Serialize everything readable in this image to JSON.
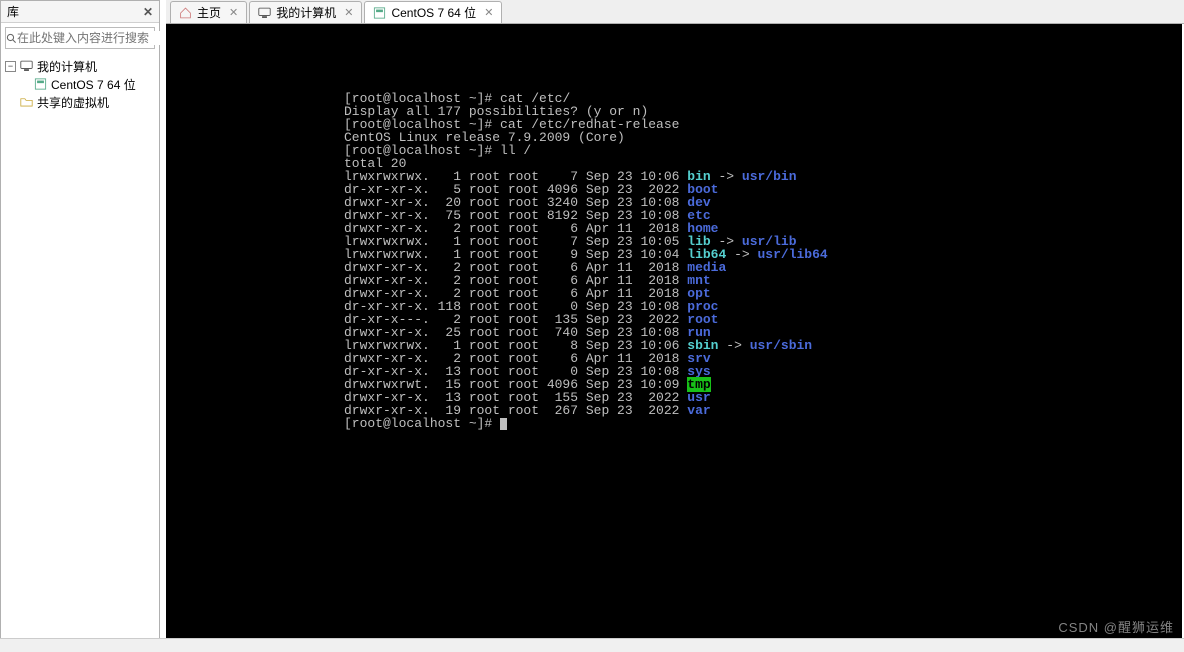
{
  "sidebar": {
    "title": "库",
    "search_placeholder": "在此处键入内容进行搜索",
    "tree": {
      "root": "我的计算机",
      "vm": "CentOS 7 64 位",
      "shared": "共享的虚拟机"
    }
  },
  "tabs": {
    "home": "主页",
    "mycomputer": "我的计算机",
    "centos": "CentOS 7 64 位"
  },
  "terminal": {
    "l1_prompt": "[root@localhost ~]# ",
    "l1_cmd": "cat /etc/",
    "l2": "Display all 177 possibilities? (y or n)",
    "l3_prompt": "[root@localhost ~]# ",
    "l3_cmd": "cat /etc/redhat-release",
    "l4": "CentOS Linux release 7.9.2009 (Core)",
    "l5_prompt": "[root@localhost ~]# ",
    "l5_cmd": "ll /",
    "l6": "total 20",
    "rows": [
      {
        "perm": "lrwxrwxrwx.",
        "n": "  1",
        "own": "root root",
        "sz": "   7",
        "date": "Sep 23 10:06",
        "name": "bin",
        "type": "lnk",
        "arrow": " -> ",
        "target": "usr/bin"
      },
      {
        "perm": "dr-xr-xr-x.",
        "n": "  5",
        "own": "root root",
        "sz": "4096",
        "date": "Sep 23  2022",
        "name": "boot",
        "type": "dir"
      },
      {
        "perm": "drwxr-xr-x.",
        "n": " 20",
        "own": "root root",
        "sz": "3240",
        "date": "Sep 23 10:08",
        "name": "dev",
        "type": "dir"
      },
      {
        "perm": "drwxr-xr-x.",
        "n": " 75",
        "own": "root root",
        "sz": "8192",
        "date": "Sep 23 10:08",
        "name": "etc",
        "type": "dir"
      },
      {
        "perm": "drwxr-xr-x.",
        "n": "  2",
        "own": "root root",
        "sz": "   6",
        "date": "Apr 11  2018",
        "name": "home",
        "type": "dir"
      },
      {
        "perm": "lrwxrwxrwx.",
        "n": "  1",
        "own": "root root",
        "sz": "   7",
        "date": "Sep 23 10:05",
        "name": "lib",
        "type": "lnk",
        "arrow": " -> ",
        "target": "usr/lib"
      },
      {
        "perm": "lrwxrwxrwx.",
        "n": "  1",
        "own": "root root",
        "sz": "   9",
        "date": "Sep 23 10:04",
        "name": "lib64",
        "type": "lnk",
        "arrow": " -> ",
        "target": "usr/lib64"
      },
      {
        "perm": "drwxr-xr-x.",
        "n": "  2",
        "own": "root root",
        "sz": "   6",
        "date": "Apr 11  2018",
        "name": "media",
        "type": "dir"
      },
      {
        "perm": "drwxr-xr-x.",
        "n": "  2",
        "own": "root root",
        "sz": "   6",
        "date": "Apr 11  2018",
        "name": "mnt",
        "type": "dir"
      },
      {
        "perm": "drwxr-xr-x.",
        "n": "  2",
        "own": "root root",
        "sz": "   6",
        "date": "Apr 11  2018",
        "name": "opt",
        "type": "dir"
      },
      {
        "perm": "dr-xr-xr-x.",
        "n": "118",
        "own": "root root",
        "sz": "   0",
        "date": "Sep 23 10:08",
        "name": "proc",
        "type": "dir"
      },
      {
        "perm": "dr-xr-x---.",
        "n": "  2",
        "own": "root root",
        "sz": " 135",
        "date": "Sep 23  2022",
        "name": "root",
        "type": "dir"
      },
      {
        "perm": "drwxr-xr-x.",
        "n": " 25",
        "own": "root root",
        "sz": " 740",
        "date": "Sep 23 10:08",
        "name": "run",
        "type": "dir"
      },
      {
        "perm": "lrwxrwxrwx.",
        "n": "  1",
        "own": "root root",
        "sz": "   8",
        "date": "Sep 23 10:06",
        "name": "sbin",
        "type": "lnk",
        "arrow": " -> ",
        "target": "usr/sbin"
      },
      {
        "perm": "drwxr-xr-x.",
        "n": "  2",
        "own": "root root",
        "sz": "   6",
        "date": "Apr 11  2018",
        "name": "srv",
        "type": "dir"
      },
      {
        "perm": "dr-xr-xr-x.",
        "n": " 13",
        "own": "root root",
        "sz": "   0",
        "date": "Sep 23 10:08",
        "name": "sys",
        "type": "dir"
      },
      {
        "perm": "drwxrwxrwt.",
        "n": " 15",
        "own": "root root",
        "sz": "4096",
        "date": "Sep 23 10:09",
        "name": "tmp",
        "type": "tmp"
      },
      {
        "perm": "drwxr-xr-x.",
        "n": " 13",
        "own": "root root",
        "sz": " 155",
        "date": "Sep 23  2022",
        "name": "usr",
        "type": "dir"
      },
      {
        "perm": "drwxr-xr-x.",
        "n": " 19",
        "own": "root root",
        "sz": " 267",
        "date": "Sep 23  2022",
        "name": "var",
        "type": "dir"
      }
    ],
    "last_prompt": "[root@localhost ~]# "
  },
  "watermark": "CSDN @醒狮运维",
  "status": ""
}
